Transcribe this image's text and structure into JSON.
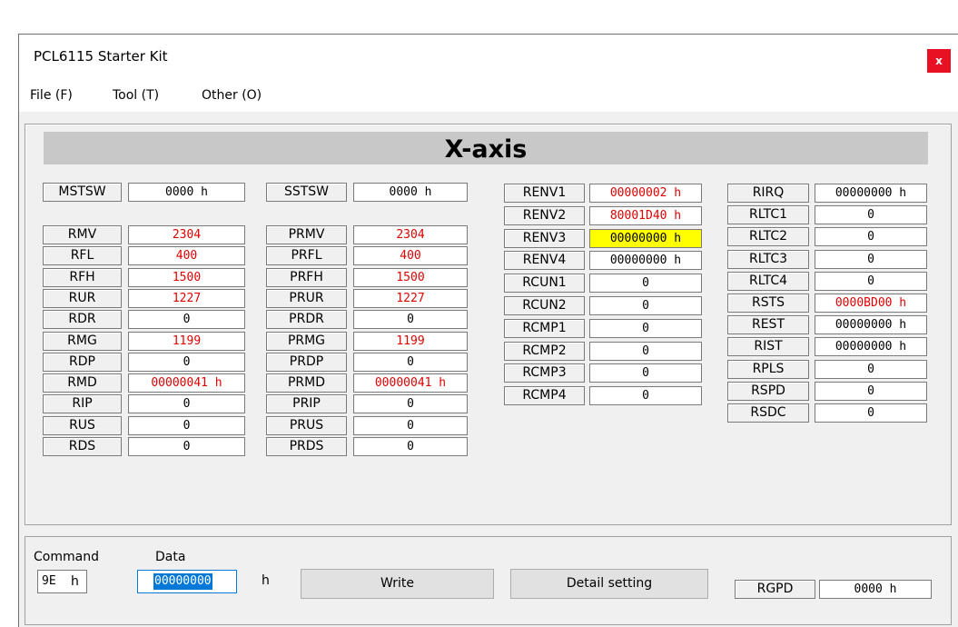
{
  "window": {
    "title": "PCL6115 Starter Kit",
    "close_label": "x"
  },
  "menu": {
    "items": [
      "File (F)",
      "Tool (T)",
      "Other (O)"
    ]
  },
  "axis_title": "X-axis",
  "col1": {
    "status": {
      "label": "MSTSW",
      "value": "0000 h"
    },
    "regs": [
      {
        "label": "RMV",
        "value": "2304",
        "red": true
      },
      {
        "label": "RFL",
        "value": "400",
        "red": true
      },
      {
        "label": "RFH",
        "value": "1500",
        "red": true
      },
      {
        "label": "RUR",
        "value": "1227",
        "red": true
      },
      {
        "label": "RDR",
        "value": "0",
        "red": false
      },
      {
        "label": "RMG",
        "value": "1199",
        "red": true
      },
      {
        "label": "RDP",
        "value": "0",
        "red": false
      },
      {
        "label": "RMD",
        "value": "00000041 h",
        "red": true
      },
      {
        "label": "RIP",
        "value": "0",
        "red": false
      },
      {
        "label": "RUS",
        "value": "0",
        "red": false
      },
      {
        "label": "RDS",
        "value": "0",
        "red": false
      }
    ]
  },
  "col2": {
    "status": {
      "label": "SSTSW",
      "value": "0000 h"
    },
    "regs": [
      {
        "label": "PRMV",
        "value": "2304",
        "red": true
      },
      {
        "label": "PRFL",
        "value": "400",
        "red": true
      },
      {
        "label": "PRFH",
        "value": "1500",
        "red": true
      },
      {
        "label": "PRUR",
        "value": "1227",
        "red": true
      },
      {
        "label": "PRDR",
        "value": "0",
        "red": false
      },
      {
        "label": "PRMG",
        "value": "1199",
        "red": true
      },
      {
        "label": "PRDP",
        "value": "0",
        "red": false
      },
      {
        "label": "PRMD",
        "value": "00000041 h",
        "red": true
      },
      {
        "label": "PRIP",
        "value": "0",
        "red": false
      },
      {
        "label": "PRUS",
        "value": "0",
        "red": false
      },
      {
        "label": "PRDS",
        "value": "0",
        "red": false
      }
    ]
  },
  "col3": {
    "regs": [
      {
        "label": "RENV1",
        "value": "00000002 h",
        "red": true
      },
      {
        "label": "RENV2",
        "value": "80001D40 h",
        "red": true
      },
      {
        "label": "RENV3",
        "value": "00000000 h",
        "red": false,
        "highlight": true
      },
      {
        "label": "RENV4",
        "value": "00000000 h",
        "red": false
      },
      {
        "label": "RCUN1",
        "value": "0",
        "red": false
      },
      {
        "label": "RCUN2",
        "value": "0",
        "red": false
      },
      {
        "label": "RCMP1",
        "value": "0",
        "red": false
      },
      {
        "label": "RCMP2",
        "value": "0",
        "red": false
      },
      {
        "label": "RCMP3",
        "value": "0",
        "red": false
      },
      {
        "label": "RCMP4",
        "value": "0",
        "red": false
      }
    ]
  },
  "col4": {
    "regs": [
      {
        "label": "RIRQ",
        "value": "00000000 h",
        "red": false
      },
      {
        "label": "RLTC1",
        "value": "0",
        "red": false
      },
      {
        "label": "RLTC2",
        "value": "0",
        "red": false
      },
      {
        "label": "RLTC3",
        "value": "0",
        "red": false
      },
      {
        "label": "RLTC4",
        "value": "0",
        "red": false
      },
      {
        "label": "RSTS",
        "value": "0000BD00 h",
        "red": true
      },
      {
        "label": "REST",
        "value": "00000000 h",
        "red": false
      },
      {
        "label": "RIST",
        "value": "00000000 h",
        "red": false
      },
      {
        "label": "RPLS",
        "value": "0",
        "red": false
      },
      {
        "label": "RSPD",
        "value": "0",
        "red": false
      },
      {
        "label": "RSDC",
        "value": "0",
        "red": false
      }
    ]
  },
  "bottom": {
    "command_label": "Command",
    "data_label": "Data",
    "command_value": "9E",
    "h_suffix": "h",
    "data_value": "00000000",
    "write_button": "Write",
    "detail_button": "Detail setting",
    "rgpd_label": "RGPD",
    "rgpd_value": "0000 h"
  },
  "colors": {
    "red_text": "#e00000",
    "highlight": "#ffff00",
    "close_bg": "#e81123"
  }
}
